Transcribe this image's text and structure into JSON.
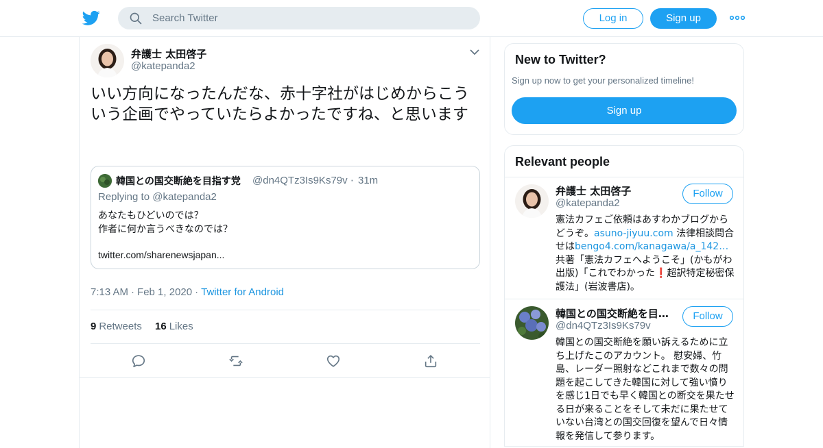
{
  "header": {
    "search_placeholder": "Search Twitter",
    "login_label": "Log in",
    "signup_label": "Sign up",
    "brand_color": "#1da1f2"
  },
  "tweet": {
    "author_name": "弁護士 太田啓子",
    "author_handle": "@katepanda2",
    "text": "いい方向になったんだな、赤十字社がはじめからこういう企画でやっていたらよかったですね、と思います",
    "quote": {
      "name": "韓国との国交断絶を目指す党",
      "handle": "@dn4QTz3Is9Ks79v",
      "dot": "·",
      "time": "31m",
      "replying": "Replying to @katepanda2",
      "line1": "あなたもひどいのでは？",
      "line2": "作者に何か言うべきなのでは？",
      "line3": "twitter.com/sharenewsjapan..."
    },
    "time": "7:13 AM",
    "date": "Feb 1, 2020",
    "dot": "·",
    "source": "Twitter for Android",
    "retweets_count": "9",
    "retweets_label": "Retweets",
    "likes_count": "16",
    "likes_label": "Likes"
  },
  "sidebar": {
    "new_title": "New to Twitter?",
    "new_sub": "Sign up now to get your personalized timeline!",
    "new_button": "Sign up",
    "relevant_title": "Relevant people",
    "people": [
      {
        "name": "弁護士 太田啓子",
        "handle": "@katepanda2",
        "follow": "Follow",
        "bio_parts": [
          "憲法カフェご依頼はあすわかブログからどうぞ。",
          "asuno-jiyuu.com",
          " 法律相談問合せは",
          "bengo4.com/kanagawa/a_142…",
          " 共著「憲法カフェへようこそ」(かもがわ出版)「これでわかった",
          "❗",
          "超訳特定秘密保護法」(岩波書店)。"
        ]
      },
      {
        "name": "韓国との国交断絶を目…",
        "handle": "@dn4QTz3Is9Ks79v",
        "follow": "Follow",
        "bio": "韓国との国交断絶を願い訴えるために立ち上げたこのアカウント。 慰安婦、竹島、レーダー照射などこれまで数々の問題を起こしてきた韓国に対して強い憤りを感じ1日でも早く韓国との断交を果たせる日が来ることをそして未だに果たせていない台湾との国交回復を望んで日々情報を発信して参ります。"
      }
    ]
  }
}
